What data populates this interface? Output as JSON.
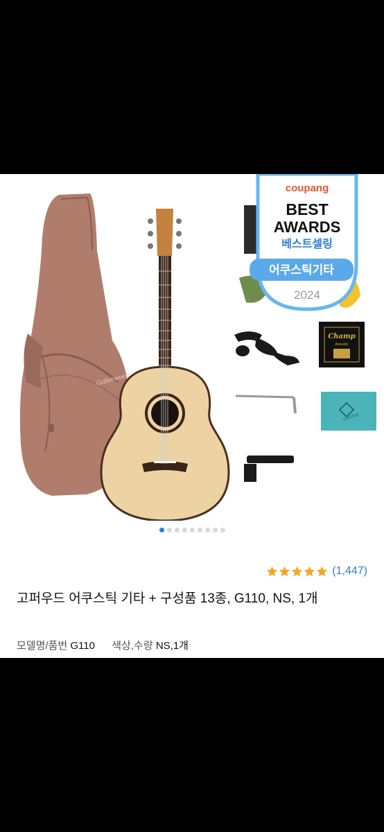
{
  "badge": {
    "brand": "coupang",
    "line1": "BEST",
    "line2": "AWARDS",
    "korean": "베스트셀링",
    "category": "어쿠스틱기타",
    "year": "2024"
  },
  "strings_pack": {
    "brand": "Champ",
    "subtitle": "Acoustic"
  },
  "cloth_brand": "CASTLE",
  "guitar_logo": "Goferwood",
  "carousel": {
    "total": 9,
    "active": 0
  },
  "rating": {
    "stars": 5,
    "count": "(1,447)"
  },
  "product": {
    "title": "고퍼우드 어쿠스틱 기타 + 구성품 13종, G110, NS, 1개",
    "model_label": "모델명/품번",
    "model_value": "G110",
    "option_label": "색상,수량",
    "option_value": "NS,1개"
  },
  "colors": {
    "accent_blue": "#2f7fd8",
    "star": "#f6a623",
    "case": "#b07d6d",
    "guitar_top": "#edd3a4"
  }
}
